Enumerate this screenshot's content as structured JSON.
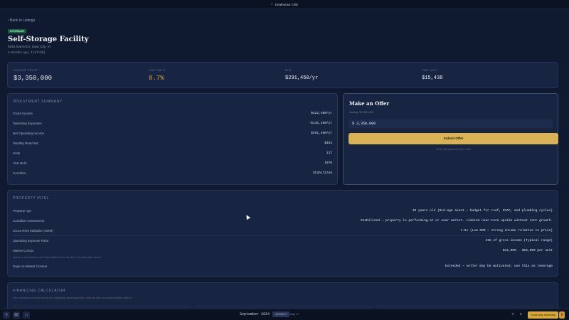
{
  "topbar": {
    "logo_glyph": "⌂",
    "title": "Dealhouse CRE"
  },
  "back_link": "‹ Back to Listings",
  "property": {
    "badge": "STORAGE",
    "name": "Self-Storage Facility",
    "address": "5581 Barrel Dr, Iowa City, IA",
    "listed": "4 Months ago, 3 (27/4/8)"
  },
  "metrics": [
    {
      "label": "ASKING PRICE",
      "value": "$3,350,000"
    },
    {
      "label": "CAP RATE",
      "value": "8.7%"
    },
    {
      "label": "NOI",
      "value": "$291,450/yr"
    },
    {
      "label": "PER UNIT",
      "value": "$15,438"
    }
  ],
  "summary": {
    "title": "INVESTMENT SUMMARY",
    "rows": [
      {
        "k": "Gross Income",
        "v": "$422,460/yr"
      },
      {
        "k": "Operating Expenses",
        "v": "-$131,250/yr"
      },
      {
        "k": "Net Operating Income",
        "v": "$291,450/yr"
      },
      {
        "k": "Monthly Rent/Unit",
        "v": "$163"
      },
      {
        "k": "Units",
        "v": "217"
      },
      {
        "k": "Year Built",
        "v": "1976"
      },
      {
        "k": "Condition",
        "v": "Stabilized"
      }
    ]
  },
  "offer": {
    "title": "Make an Offer",
    "asking": "Asking: $3,350,000",
    "input_value": "$ 3,350,000",
    "submit": "Submit Offer",
    "note": "Seller will respond to your offer"
  },
  "intel": {
    "title": "PROPERTY INTEL",
    "rows": [
      {
        "k": "Property Age",
        "v": "39 years old (Mid-age asset — budget for roof, HVAC, and plumbing cycles)"
      },
      {
        "k": "Condition Assessment",
        "v": "Stabilized — property is performing at or near market. Limited near-term upside without rent growth."
      },
      {
        "k": "Gross Rent Multiplier (GRM)",
        "v": "7.9x (Low GRM — strong income relative to price)"
      },
      {
        "k": "Operating Expense Ratio",
        "v": "31% of gross income (Typical range)"
      },
      {
        "k": "Market Comps",
        "v": "$14,000 - $18,000 per unit"
      },
      {
        "k": "Days on Market Context",
        "v": "Extended — seller may be motivated, use this as leverage"
      }
    ],
    "comps_note": "Based on comparable Iowa City facilities sold in the last 12 months within radius."
  },
  "financing": {
    "title": "FINANCING CALCULATOR",
    "subtitle": "Run scenarios on loan terms by adjusting down payment, interest rate and amortization period."
  },
  "bottombar": {
    "date": "September 2024",
    "pill": "SEARCH",
    "step": "Day 17",
    "right_a": "⟲",
    "right_b": "$",
    "action": "Close day summary",
    "caret": "▾",
    "icons": [
      "≡",
      "▤",
      "⌂"
    ]
  }
}
